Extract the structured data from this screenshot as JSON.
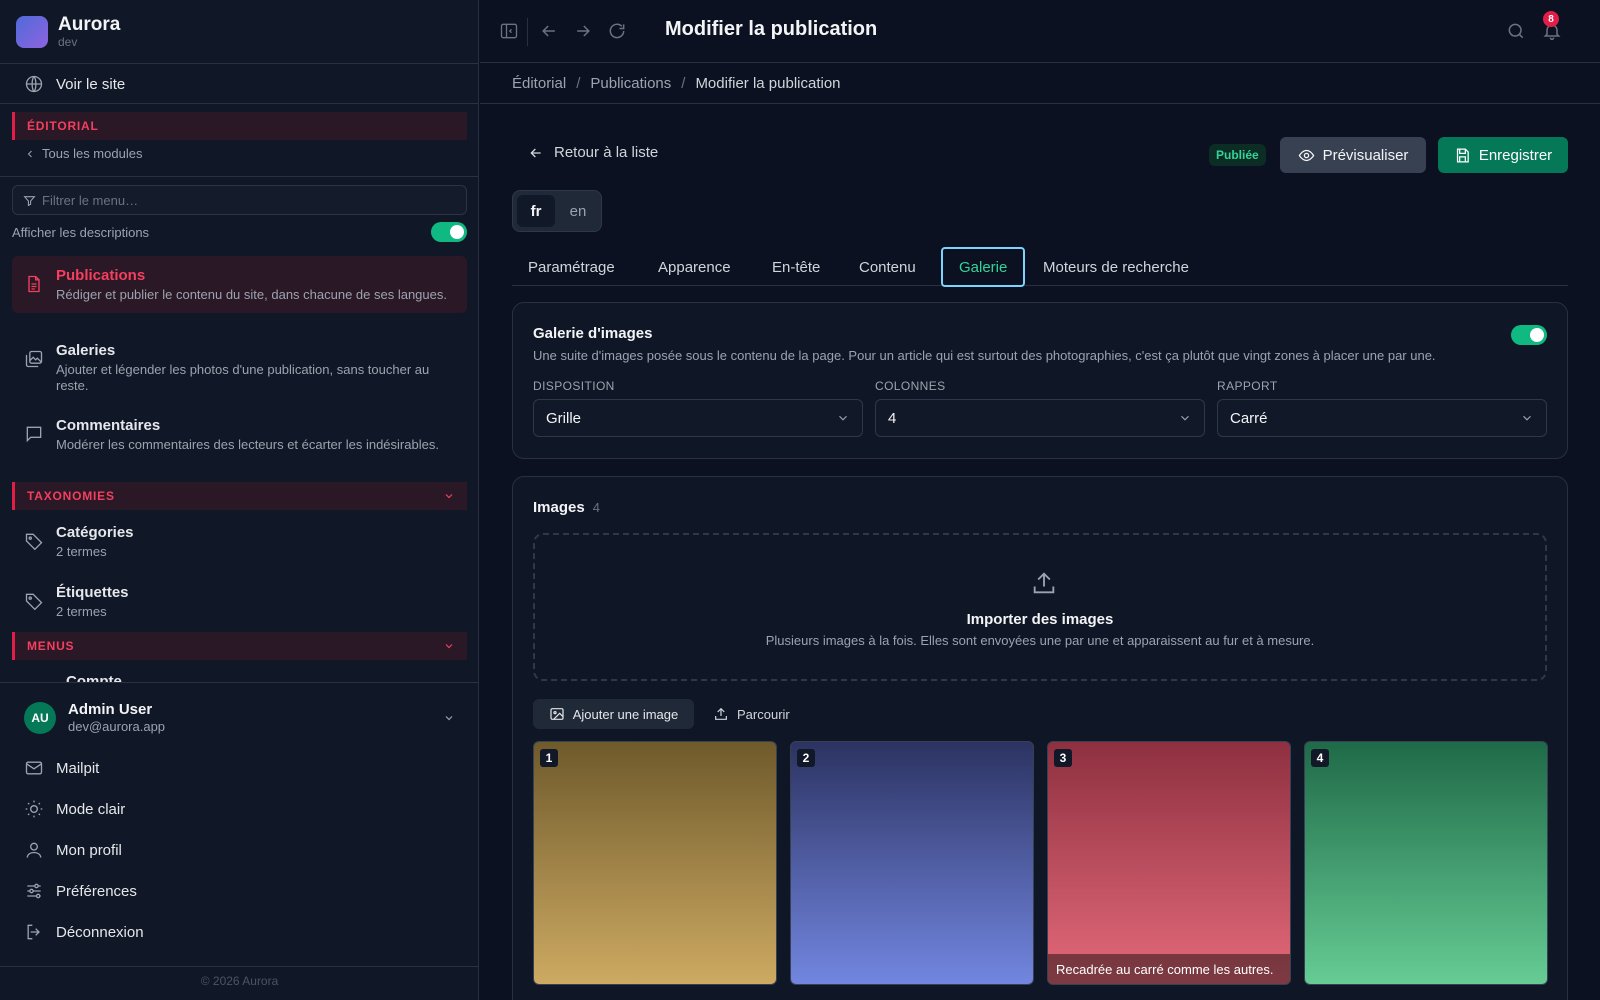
{
  "app": {
    "name": "Aurora",
    "env": "dev"
  },
  "sidebar": {
    "view_site": "Voir le site",
    "editorial_header": "ÉDITORIAL",
    "back_modules": "Tous les modules",
    "filter_placeholder": "Filtrer le menu…",
    "show_descriptions": "Afficher les descriptions",
    "show_descriptions_on": true,
    "items": [
      {
        "title": "Publications",
        "desc": "Rédiger et publier le contenu du site, dans chacune de ses langues.",
        "active": true
      },
      {
        "title": "Galeries",
        "desc": "Ajouter et légender les photos d'une publication, sans toucher au reste."
      },
      {
        "title": "Commentaires",
        "desc": "Modérer les commentaires des lecteurs et écarter les indésirables."
      }
    ],
    "taxonomies_header": "TAXONOMIES",
    "taxonomies": [
      {
        "title": "Catégories",
        "sub": "2 termes"
      },
      {
        "title": "Étiquettes",
        "sub": "2 termes"
      }
    ],
    "menus_header": "MENUS",
    "menus_cut_item": "Compte",
    "user": {
      "initials": "AU",
      "name": "Admin User",
      "email": "dev@aurora.app"
    },
    "footer": [
      "Mailpit",
      "Mode clair",
      "Mon profil",
      "Préférences",
      "Déconnexion"
    ],
    "copyright": "© 2026 Aurora"
  },
  "topbar": {
    "title": "Modifier la publication",
    "notifications": "8"
  },
  "breadcrumb": [
    "Éditorial",
    "Publications",
    "Modifier la publication"
  ],
  "main": {
    "back_label": "Retour à la liste",
    "status": "Publiée",
    "preview_label": "Prévisualiser",
    "save_label": "Enregistrer",
    "languages": [
      "fr",
      "en"
    ],
    "active_language": "fr",
    "tabs": [
      "Paramétrage",
      "Apparence",
      "En-tête",
      "Contenu",
      "Galerie",
      "Moteurs de recherche"
    ],
    "active_tab": "Galerie",
    "gallery": {
      "title": "Galerie d'images",
      "description": "Une suite d'images posée sous le contenu de la page. Pour un article qui est surtout des photographies, c'est ça plutôt que vingt zones à placer une par une.",
      "enabled": true,
      "fields": [
        {
          "label": "DISPOSITION",
          "value": "Grille"
        },
        {
          "label": "COLONNES",
          "value": "4"
        },
        {
          "label": "RAPPORT",
          "value": "Carré"
        }
      ]
    },
    "images": {
      "title": "Images",
      "count": "4",
      "upload_title": "Importer des images",
      "upload_sub": "Plusieurs images à la fois. Elles sont envoyées une par une et apparaissent au fur et à mesure.",
      "add_label": "Ajouter une image",
      "browse_label": "Parcourir",
      "items": [
        {
          "num": "1",
          "caption": "",
          "top": "#6f5a2c",
          "bottom": "#cdaa62"
        },
        {
          "num": "2",
          "caption": "",
          "top": "#2c3362",
          "bottom": "#7286e0"
        },
        {
          "num": "3",
          "caption": "Recadrée au carré comme les autres.",
          "top": "#8e3040",
          "bottom": "#e46a7a"
        },
        {
          "num": "4",
          "caption": "",
          "top": "#1f6a48",
          "bottom": "#66cc94"
        }
      ]
    }
  }
}
